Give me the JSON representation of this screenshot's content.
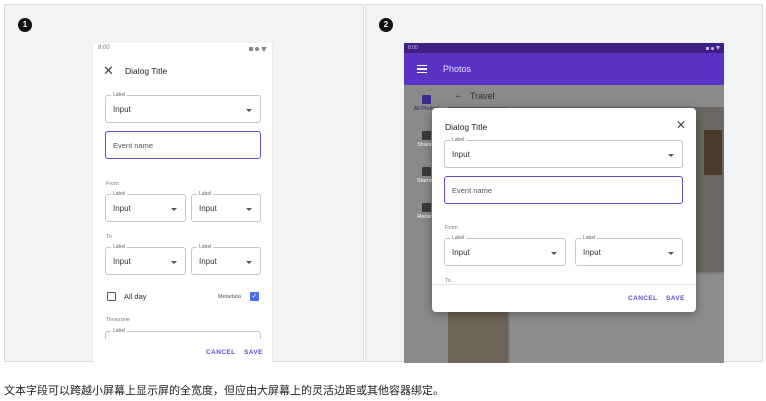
{
  "caption": "文本字段可以跨越小屏幕上显示屏的全宽度，但应由大屏幕上的灵活边距或其他容器绑定。",
  "examples": [
    {
      "badge": "1",
      "status_time": "8:00",
      "dialog_title": "Dialog Title",
      "select_label": "Label",
      "select_value": "Input",
      "event_placeholder": "Event name",
      "from_caption": "From",
      "to_caption": "To",
      "pair_label": "Label",
      "pair_value": "Input",
      "all_day_label": "All day",
      "metadata_label": "Metadata",
      "timezone_caption": "Timezone",
      "timezone_label": "Label",
      "cancel_label": "CANCEL",
      "save_label": "SAVE"
    },
    {
      "badge": "2",
      "status_time": "8:00",
      "app_title": "Photos",
      "rail": [
        "All Photos",
        "Shared",
        "Starred",
        "Recent"
      ],
      "album_title": "Travel",
      "dialog_title": "Dialog Title",
      "select_label": "Label",
      "select_value": "Input",
      "event_placeholder": "Event name",
      "from_caption": "From",
      "pair_label": "Label",
      "pair_value": "Input",
      "to_caption": "To",
      "cancel_label": "CANCEL",
      "save_label": "SAVE"
    }
  ],
  "colors": {
    "accent": "#5c4ec9",
    "app_bar": "#5a32c4",
    "checkbox": "#4a6cf7",
    "scrim": "#7c7c7c"
  },
  "icons": {
    "close": "close-icon",
    "dropdown": "chevron-down-icon",
    "menu": "menu-icon",
    "back": "arrow-back-icon"
  }
}
